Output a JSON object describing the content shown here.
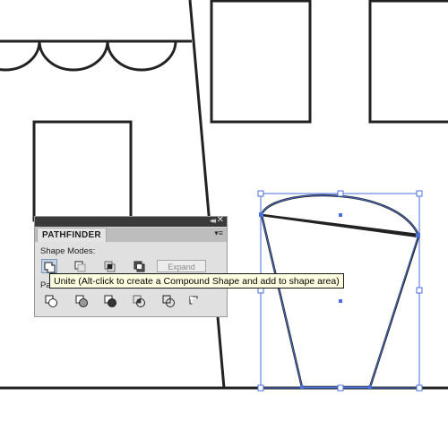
{
  "panel": {
    "collapse_glyph": "◂◂",
    "close_glyph": "✕",
    "tab_label": "PATHFINDER",
    "menu_glyph": "▾≡",
    "shape_modes_label": "Shape Modes:",
    "pathfinders_label": "Pa",
    "expand_label": "Expand",
    "shape_mode_buttons": [
      "unite",
      "minus-front",
      "intersect",
      "exclude"
    ],
    "pathfinder_buttons": [
      "divide",
      "trim",
      "merge",
      "crop",
      "outline",
      "minus-back"
    ]
  },
  "tooltip": {
    "text": "Unite (Alt-click to create a Compound Shape and add to shape area)"
  },
  "colors": {
    "selection": "#4a6fd8",
    "panel_bg": "#e0e0e0",
    "tooltip_bg": "#ffffe1"
  }
}
